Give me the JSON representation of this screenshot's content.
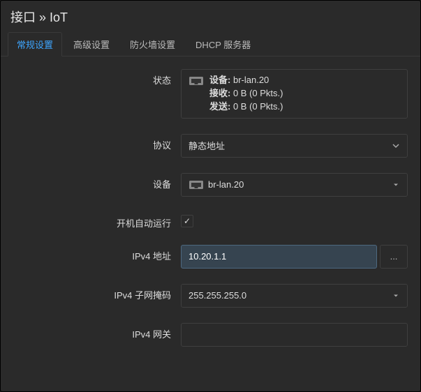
{
  "header": {
    "title": "接口 » IoT"
  },
  "tabs": [
    {
      "label": "常规设置",
      "active": true
    },
    {
      "label": "高级设置",
      "active": false
    },
    {
      "label": "防火墙设置",
      "active": false
    },
    {
      "label": "DHCP 服务器",
      "active": false
    }
  ],
  "form": {
    "status": {
      "label": "状态",
      "device_label": "设备:",
      "device_value": "br-lan.20",
      "rx_label": "接收:",
      "rx_value": "0 B (0 Pkts.)",
      "tx_label": "发送:",
      "tx_value": "0 B (0 Pkts.)"
    },
    "protocol": {
      "label": "协议",
      "value": "静态地址"
    },
    "device": {
      "label": "设备",
      "value": "br-lan.20"
    },
    "autostart": {
      "label": "开机自动运行",
      "checked": true
    },
    "ipv4_addr": {
      "label": "IPv4 地址",
      "value": "10.20.1.1",
      "more": "..."
    },
    "ipv4_mask": {
      "label": "IPv4 子网掩码",
      "value": "255.255.255.0"
    },
    "ipv4_gw": {
      "label": "IPv4 网关",
      "value": ""
    }
  }
}
